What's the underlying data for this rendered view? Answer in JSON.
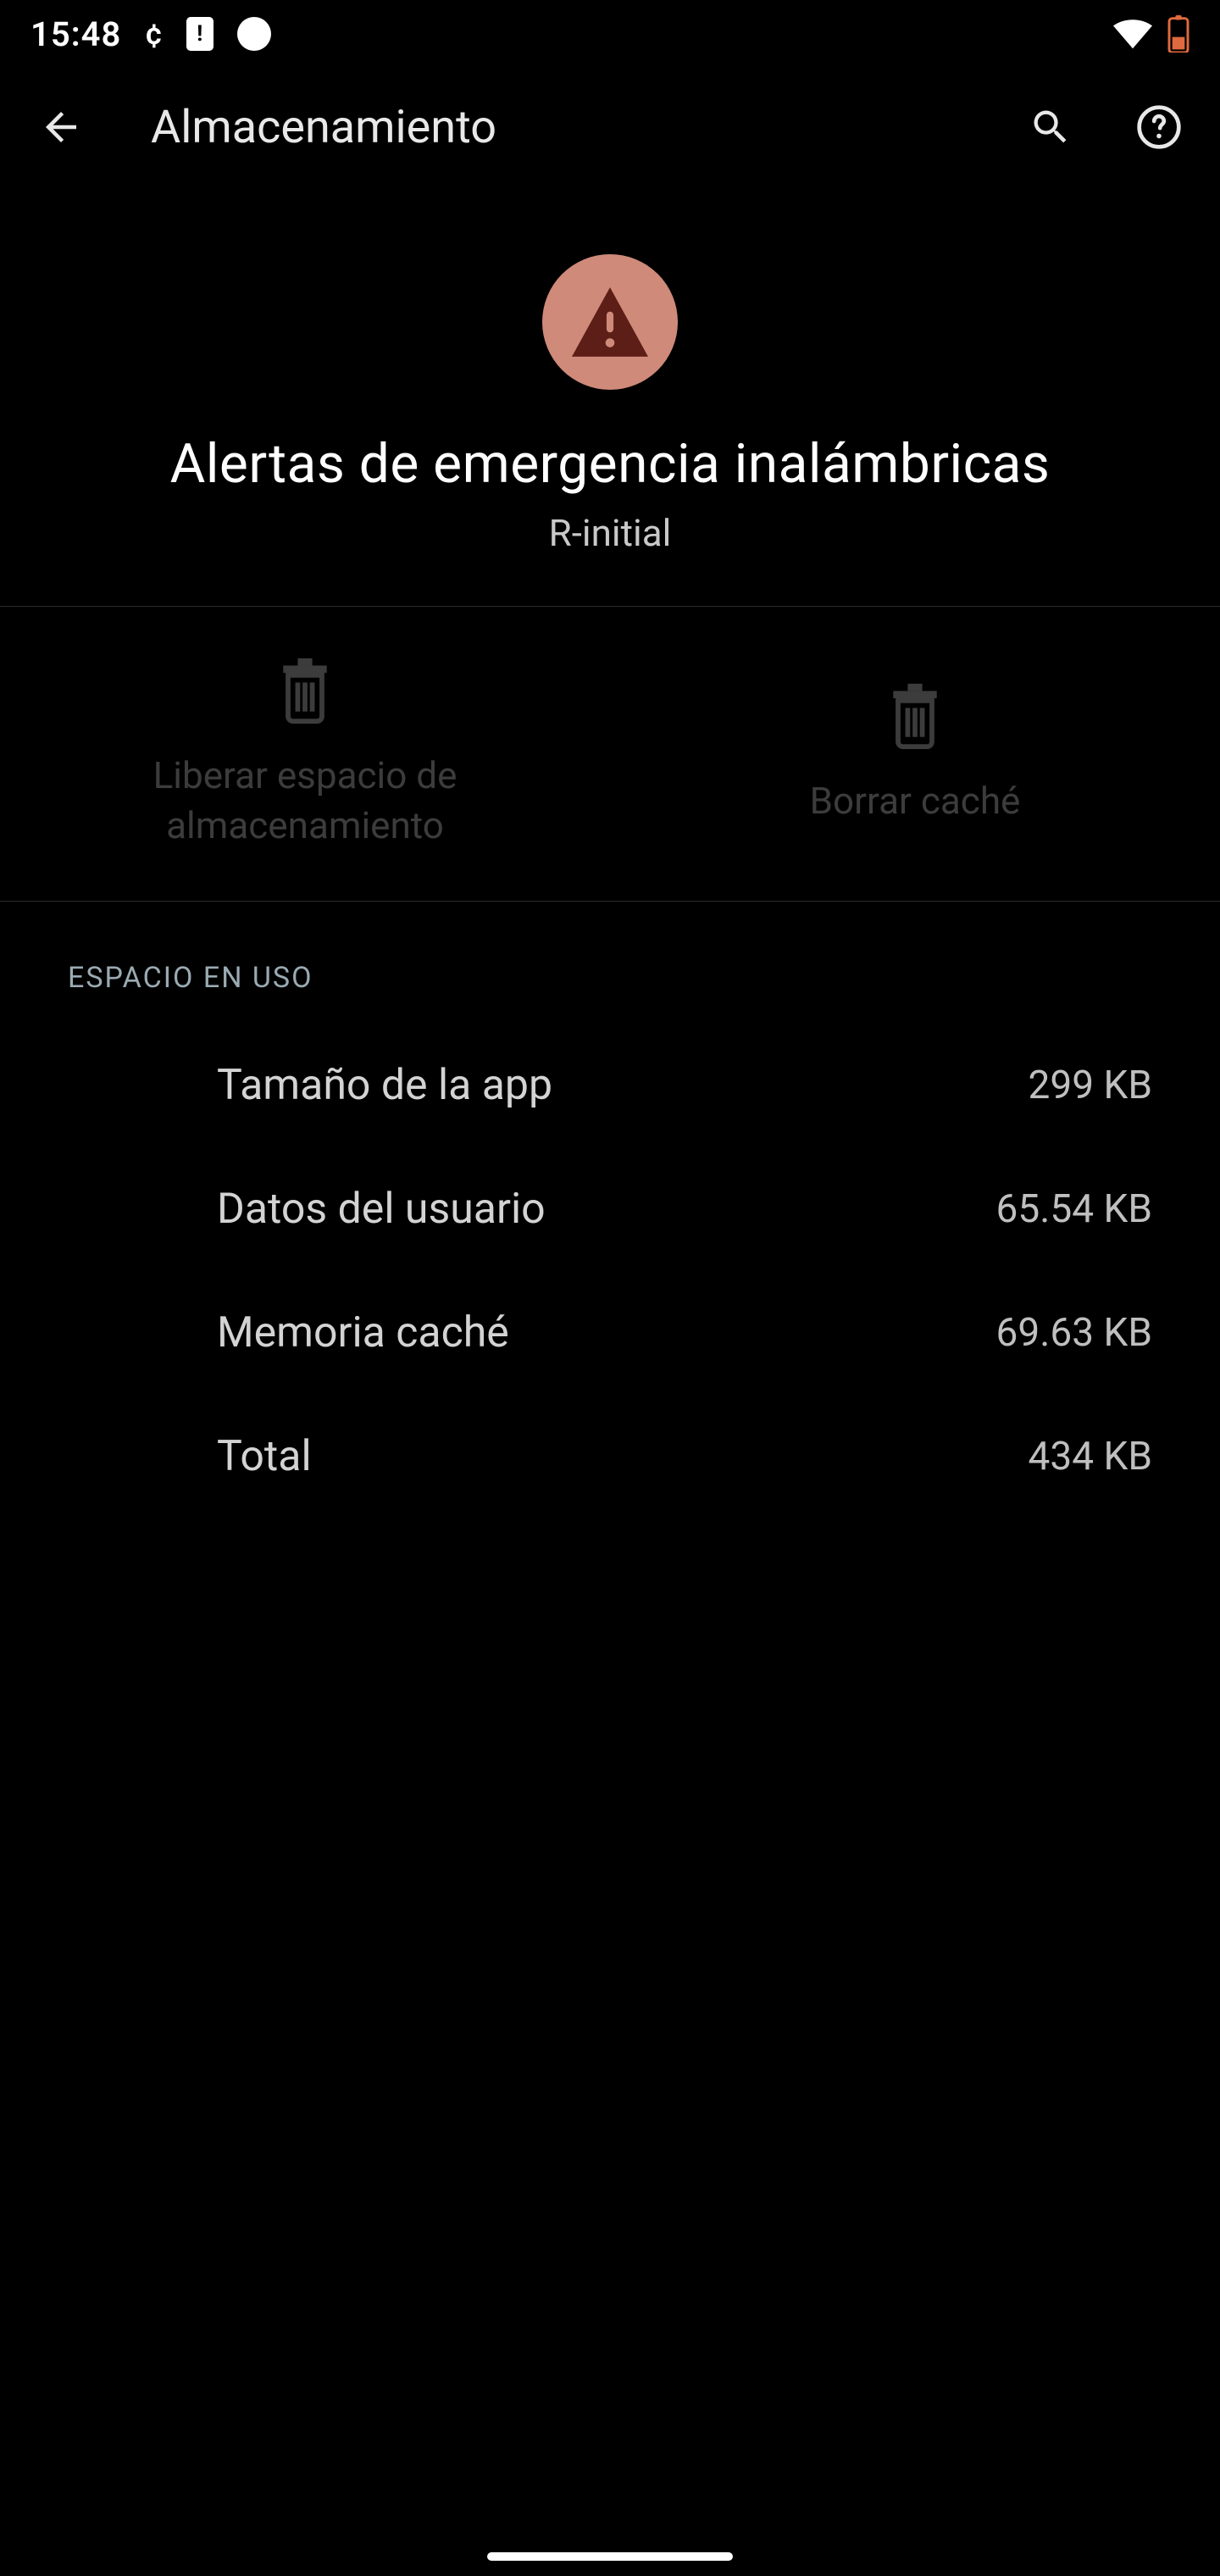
{
  "statusbar": {
    "time": "15:48",
    "cent_glyph": "¢"
  },
  "appbar": {
    "title": "Almacenamiento"
  },
  "hero": {
    "app_name": "Alertas de emergencia inalámbricas",
    "app_version": "R-initial"
  },
  "actions": {
    "free_space_label": "Liberar espacio de almacenamiento",
    "clear_cache_label": "Borrar caché"
  },
  "section_header": "ESPACIO EN USO",
  "rows": {
    "app_size": {
      "label": "Tamaño de la app",
      "value": "299 KB"
    },
    "user_data": {
      "label": "Datos del usuario",
      "value": "65.54 KB"
    },
    "cache": {
      "label": "Memoria caché",
      "value": "69.63 KB"
    },
    "total": {
      "label": "Total",
      "value": "434 KB"
    }
  },
  "colors": {
    "hero_icon_bg": "#cf8a7a",
    "hero_triangle": "#5c1e16"
  }
}
